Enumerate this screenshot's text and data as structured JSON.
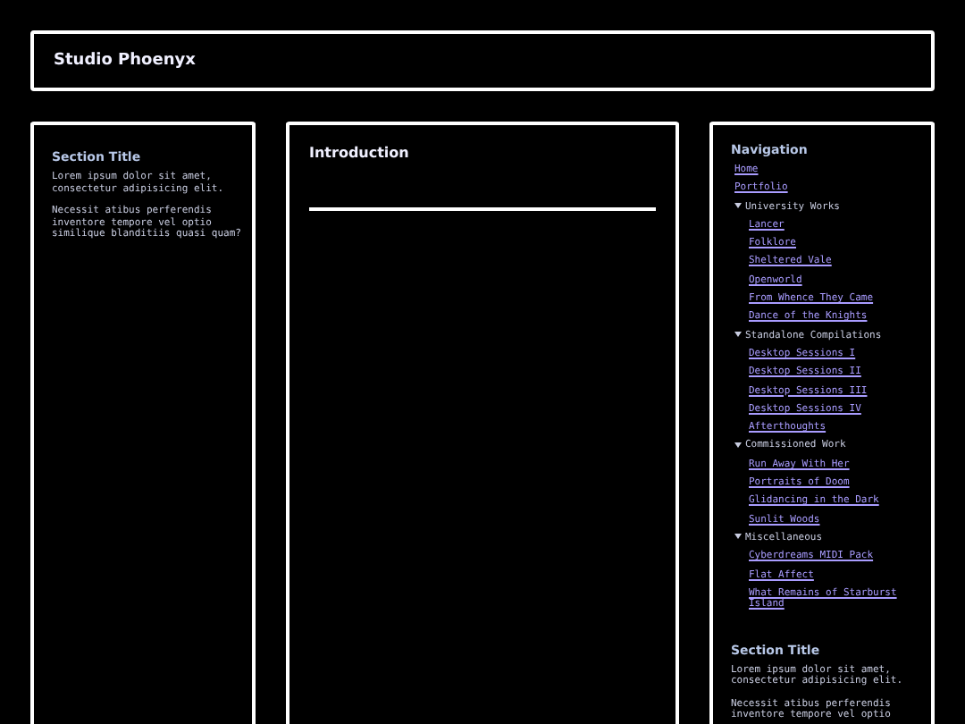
{
  "header": {
    "title": "Studio Phoenyx"
  },
  "left_panel": {
    "title": "Section Title",
    "paragraphs": [
      "Lorem ipsum dolor sit amet, consectetur adipisicing elit.",
      "Necessit atibus perferendis inventore tempore vel optio similique blanditiis quasi quam?"
    ]
  },
  "main_panel": {
    "title": "Introduction"
  },
  "navigation": {
    "title": "Navigation",
    "items": [
      {
        "kind": "link",
        "label": "Home"
      },
      {
        "kind": "link",
        "label": "Portfolio"
      },
      {
        "kind": "group",
        "label": "University Works",
        "expanded": true,
        "children": [
          {
            "label": "Lancer"
          },
          {
            "label": "Folklore"
          },
          {
            "label": "Sheltered Vale"
          },
          {
            "label": "Openworld"
          },
          {
            "label": "From Whence They Came"
          },
          {
            "label": "Dance of the Knights"
          }
        ]
      },
      {
        "kind": "group",
        "label": "Standalone Compilations",
        "expanded": true,
        "children": [
          {
            "label": "Desktop Sessions I"
          },
          {
            "label": "Desktop Sessions II"
          },
          {
            "label": "Desktop Sessions III"
          },
          {
            "label": "Desktop Sessions IV"
          },
          {
            "label": "Afterthoughts"
          }
        ]
      },
      {
        "kind": "group",
        "label": "Commissioned Work",
        "expanded": true,
        "children": [
          {
            "label": "Run Away With Her"
          },
          {
            "label": "Portraits of Doom"
          },
          {
            "label": "Glidancing in the Dark"
          },
          {
            "label": "Sunlit Woods"
          }
        ]
      },
      {
        "kind": "group",
        "label": "Miscellaneous",
        "expanded": true,
        "children": [
          {
            "label": "Cyberdreams MIDI Pack"
          },
          {
            "label": "Flat Affect"
          },
          {
            "label": "What Remains of Starburst Island"
          }
        ]
      }
    ]
  },
  "right_section": {
    "title": "Section Title",
    "paragraphs": [
      "Lorem ipsum dolor sit amet, consectetur adipisicing elit.",
      "Necessit atibus perferendis inventore tempore vel optio"
    ]
  }
}
